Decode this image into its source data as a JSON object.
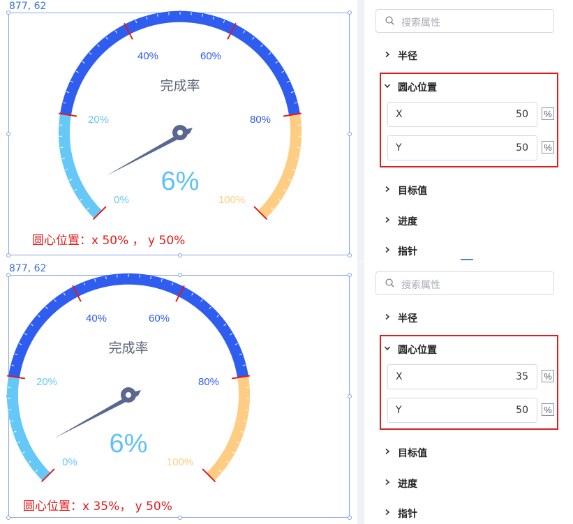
{
  "panels": [
    {
      "coord": "877, 62",
      "gauge": {
        "title": "完成率",
        "value": "6%",
        "ticks": [
          "0%",
          "20%",
          "40%",
          "60%",
          "80%",
          "100%"
        ]
      },
      "caption": "圆心位置：x  50% ，  y 50%",
      "properties": {
        "search_placeholder": "搜索属性",
        "sections": [
          "半径",
          "圆心位置",
          "目标值",
          "进度",
          "指针"
        ],
        "center": {
          "x_label": "X",
          "x_value": "50",
          "y_label": "Y",
          "y_value": "50",
          "unit": "%"
        }
      }
    },
    {
      "coord": "877, 62",
      "gauge": {
        "title": "完成率",
        "value": "6%",
        "ticks": [
          "0%",
          "20%",
          "40%",
          "60%",
          "80%",
          "100%"
        ]
      },
      "caption": "圆心位置：x 35%，  y 50%",
      "properties": {
        "search_placeholder": "搜索属性",
        "sections": [
          "半径",
          "圆心位置",
          "目标值",
          "进度",
          "指针"
        ],
        "center": {
          "x_label": "X",
          "x_value": "35",
          "y_label": "Y",
          "y_value": "50",
          "unit": "%"
        }
      }
    }
  ],
  "colors": {
    "arc_low": "#66c8f7",
    "arc_mid": "#2e5df0",
    "arc_high": "#fecd83",
    "needle": "#5a6790",
    "highlight": "#e11b1b",
    "value_text": "#5ec2f5"
  }
}
